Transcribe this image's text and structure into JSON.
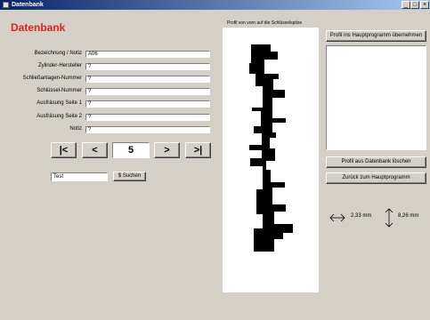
{
  "window": {
    "title": "Datenbank",
    "minimize": "_",
    "maximize": "□",
    "close": "×"
  },
  "app_title": "Datenbank",
  "form": {
    "fields": [
      {
        "label": "Bezeichnung / Notiz",
        "value": "A06"
      },
      {
        "label": "Zylinder-Hersteller",
        "value": "?"
      },
      {
        "label": "Schließanlagen-Nummer",
        "value": "?"
      },
      {
        "label": "Schlüssel-Nummer",
        "value": "?"
      },
      {
        "label": "Ausfräsung Seite 1",
        "value": "?"
      },
      {
        "label": "Ausfräsung Seite 2",
        "value": "?"
      },
      {
        "label": "Notiz",
        "value": "?"
      }
    ]
  },
  "nav": {
    "first": "|<",
    "prev": "<",
    "record": "5",
    "next": ">",
    "last": ">|"
  },
  "search": {
    "value": "Test",
    "button": "$ Suchen"
  },
  "profile": {
    "caption": "Profil von vorn auf die Schlüsselspitze"
  },
  "right": {
    "take_over": "Profil ins Hauptprogramm übernehmen",
    "delete": "Profil aus Datenbank löschen",
    "back": "Zurück zum Hauptprogramm"
  },
  "measurements": {
    "width": "2,33 mm",
    "height": "8,26 mm"
  }
}
